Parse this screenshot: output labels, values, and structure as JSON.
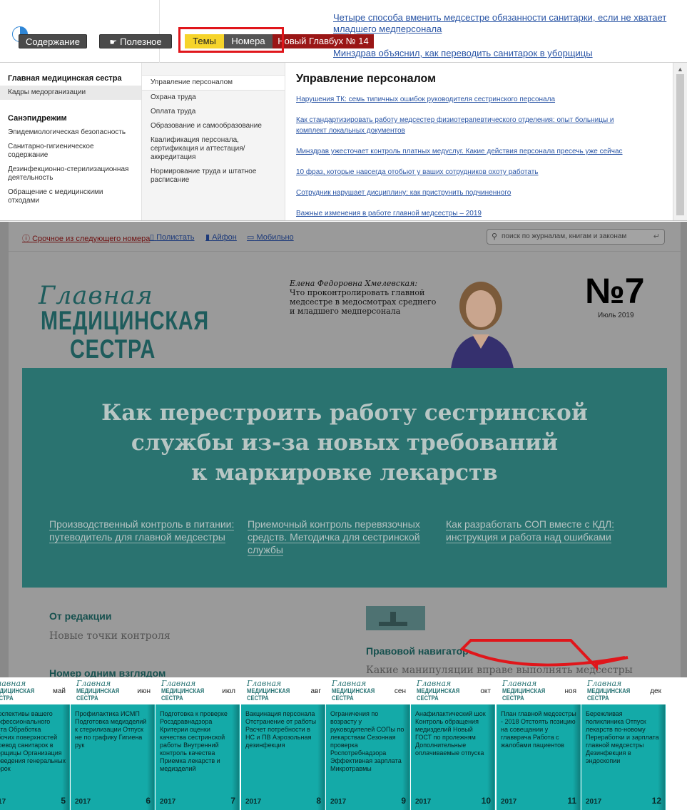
{
  "toolbar": {
    "contents_label": "Содержание",
    "useful_label": "Полезное",
    "themes_label": "Темы",
    "issues_label": "Номера",
    "new_label": "Новый Главбух № 14"
  },
  "top_news": [
    "Четыре способа вменить медсестре обязанности санитарки, если не хватает младшего медперсонала",
    "Минздрав объяснил, как переводить санитарок в уборщицы"
  ],
  "menu": {
    "col1": {
      "heading1": "Главная медицинская сестра",
      "item_active": "Кадры медорганизации",
      "heading2": "Санэпидрежим",
      "items": [
        "Эпидемиологическая безопасность",
        "Санитарно-гигиеническое содержание",
        "Дезинфекционно-стерилизационная деятельность",
        "Обращение с медицинскими отходами"
      ]
    },
    "col2": {
      "items": [
        "Управление персоналом",
        "Охрана труда",
        "Оплата труда",
        "Образование и самообразование",
        "Квалификация персонала, сертификация и аттестация/аккредитация",
        "Нормирование труда и штатное расписание"
      ]
    },
    "col3": {
      "title": "Управление персоналом",
      "articles": [
        "Нарушения ТК: семь типичных ошибок руководителя сестринского персонала",
        "Как стандартизировать работу медсестер физиотерапевтического отделения: опыт больницы и комплект локальных документов",
        "Минздрав ужесточает контроль платных медуслуг. Какие действия персонала пресечь уже сейчас",
        "10 фраз, которые навсегда отобьют у ваших сотрудников охоту работать",
        "Сотрудник нарушает дисциплину: как приструнить подчиненного",
        "Важные изменения в работе главной медсестры – 2019"
      ]
    }
  },
  "journal": {
    "links": {
      "urgent": "Срочное из следующего номера",
      "read": "Полистать",
      "iphone": "Айфон",
      "mobile": "Мобильно"
    },
    "search_placeholder": "поиск по журналам, книгам и законам",
    "logo": {
      "script": "Главная",
      "line1": "МЕДИЦИНСКАЯ",
      "line2": "СЕСТРА"
    },
    "author_name": "Елена Федоровна Хмелевская:",
    "author_text": "Что проконтролировать главной медсестре в медосмотрах среднего и младшего медперсонала",
    "issue_number": "№7",
    "issue_date": "Июль 2019",
    "hero_title_1": "Как перестроить работу сестринской",
    "hero_title_2": "службы из-за новых требований",
    "hero_title_3": "к маркировке лекарств",
    "hero_subs": [
      "Производственный контроль в питании: путеводитель для главной медсестры",
      "Приемочный контроль перевязочных средств. Методичка для сестринской службы",
      "Как разработать СОП вместе с КДЛ: инструкция и работа над ошибками"
    ],
    "sections": {
      "editorial_head": "От редакции",
      "editorial_text": "Новые точки контроля",
      "glance_head": "Номер одним взглядом",
      "legal_head": "Правовой навигатор",
      "legal_text": "Какие манипуляции вправе выполнять медсестры"
    }
  },
  "issues": [
    {
      "month": "май",
      "year": "2017",
      "num": "5",
      "text": "Перспективы вашего профессионального роста Обработка рабочих поверхностей Перевод санитарок в уборщицы Организация проведения генеральных уборок"
    },
    {
      "month": "июн",
      "year": "2017",
      "num": "6",
      "text": "Профилактика ИСМП Подготовка медизделий к стерилизации Отпуск не по графику Гигиена рук"
    },
    {
      "month": "июл",
      "year": "2017",
      "num": "7",
      "text": "Подготовка к проверке Росздравнадзора Критерии оценки качества сестринской работы Внутренний контроль качества Приемка лекарств и медизделий"
    },
    {
      "month": "авг",
      "year": "2017",
      "num": "8",
      "text": "Вакцинация персонала Отстранение от работы Расчет потребности в НС и ПВ Аэрозольная дезинфекция"
    },
    {
      "month": "сен",
      "year": "2017",
      "num": "9",
      "text": "Ограничения по возрасту у руководителей СОПы по лекарствам Сезонная проверка Роспотребнадзора Эффективная зарплата Микротравмы"
    },
    {
      "month": "окт",
      "year": "2017",
      "num": "10",
      "text": "Анафилактический шок Контроль обращения медизделий Новый ГОСТ по пролежням Дополнительные оплачиваемые отпуска"
    },
    {
      "month": "ноя",
      "year": "2017",
      "num": "11",
      "text": "План главной медсестры - 2018 Отстоять позицию на совещании у главврача Работа с жалобами пациентов"
    },
    {
      "month": "дек",
      "year": "2017",
      "num": "12",
      "text": "Бережливая поликлиника Отпуск лекарств по-новому Переработки и зарплата главной медсестры Дезинфекция в эндоскопии"
    }
  ],
  "issue_logo": {
    "script": "Главная",
    "bold": "МЕДИЦИНСКАЯ СЕСТРА"
  },
  "colors": {
    "teal": "#2a7370",
    "issue_teal": "#14aaa8",
    "highlight_red": "#e0161b",
    "tab_yellow": "#f6d42a"
  }
}
